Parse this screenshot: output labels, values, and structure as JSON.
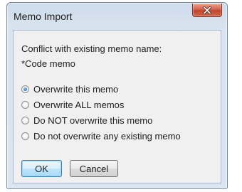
{
  "window": {
    "title": "Memo Import",
    "close_icon": "close-icon",
    "frame_color": "#dbe5f1",
    "close_color": "#c1432a"
  },
  "message": {
    "line1": "Conflict with existing memo name:",
    "line2": "*Code memo"
  },
  "options": [
    {
      "label": "Overwrite this memo",
      "checked": true
    },
    {
      "label": "Overwrite ALL memos",
      "checked": false
    },
    {
      "label": "Do NOT overwrite this memo",
      "checked": false
    },
    {
      "label": "Do not overwrite any existing memo",
      "checked": false
    }
  ],
  "buttons": {
    "ok_label": "OK",
    "cancel_label": "Cancel"
  }
}
